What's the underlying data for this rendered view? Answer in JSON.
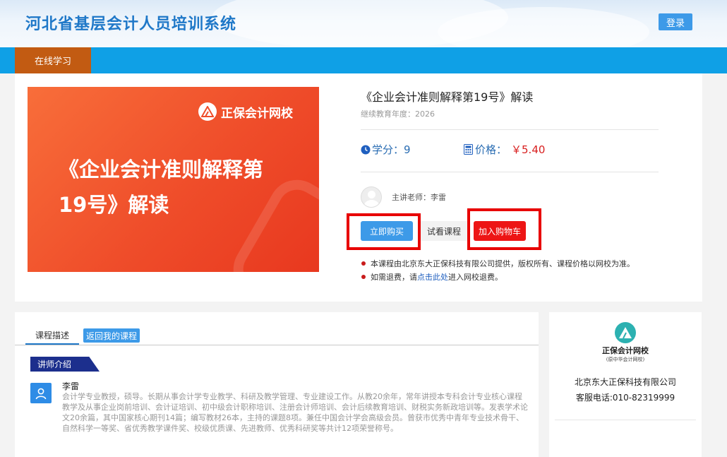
{
  "header": {
    "title": "河北省基层会计人员培训系统",
    "login_label": "登录"
  },
  "nav": {
    "items": [
      {
        "label": "在线学习",
        "active": true
      }
    ]
  },
  "course": {
    "cover": {
      "brand": "正保会计网校",
      "title_line1": "《企业会计准则解释第",
      "title_line2": "19号》解读"
    },
    "title": "《企业会计准则解释第19号》解读",
    "year_label": "继续教育年度：",
    "year": "2026",
    "credit_label": "学分：",
    "credit": "9",
    "price_label": "价格：",
    "price": "￥5.40",
    "teacher_label": "主讲老师：",
    "teacher": "李雷",
    "buttons": {
      "buy": "立即购买",
      "trial": "试看课程",
      "cart": "加入购物车"
    },
    "notes": {
      "note1": "本课程由北京东大正保科技有限公司提供，版权所有、课程价格以网校为准。",
      "note2_before": "如需退费，请",
      "note2_link": "点击此处",
      "note2_after": "进入网校退费。"
    }
  },
  "description": {
    "tabs": [
      {
        "label": "课程描述",
        "active": true
      },
      {
        "label": "返回我的课程"
      }
    ],
    "section_title": "讲师介绍",
    "lecturer": {
      "name": "李雷",
      "bio": "会计学专业教授，硕导。长期从事会计学专业教学、科研及教学管理、专业建设工作。从教20余年，常年讲授本专科会计专业核心课程教学及从事企业岗前培训、会计证培训、初中级会计职称培训、注册会计师培训、会计后续教育培训、财税实务新政培训等。发表学术论文20余篇，其中国家核心期刊14篇；编写教材26本，主持的课题8项。兼任中国会计学会高级会员。曾获市优秀中青年专业技术骨干、自然科学一等奖、省优秀教学课件奖、校级优质课、先进教师、优秀科研奖等共计12项荣誉称号。"
    }
  },
  "company": {
    "logo_name": "正保会计网校",
    "logo_sub": "(原中华会计网校)",
    "name": "北京东大正保科技有限公司",
    "phone_label": "客服电话:",
    "phone": "010-82319999"
  },
  "colors": {
    "primary": "#3d9ae8",
    "nav": "#0fa0e6",
    "nav_active": "#c25b12",
    "cart": "#ed1515",
    "highlight_frame": "#e80000"
  }
}
